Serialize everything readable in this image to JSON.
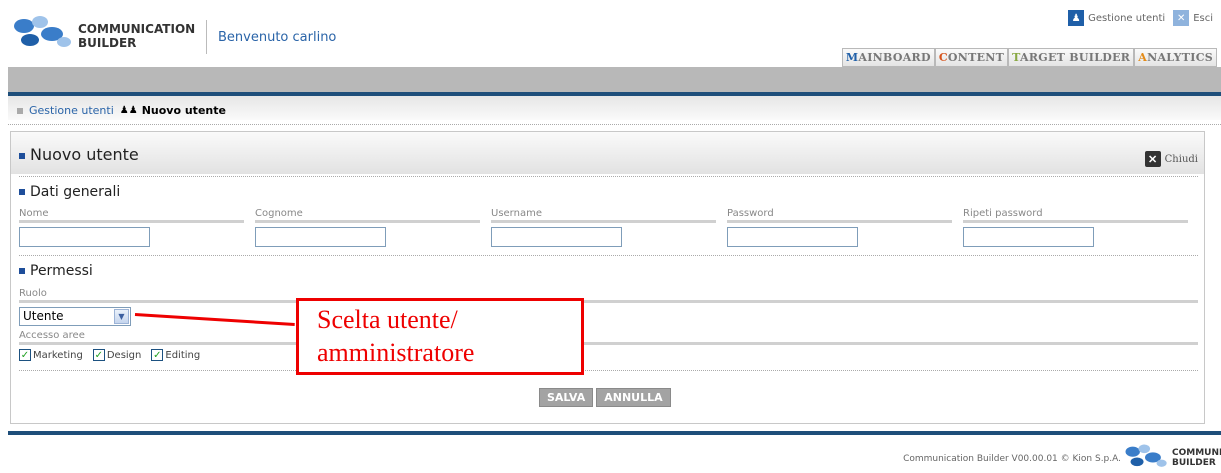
{
  "brand": {
    "line1": "COMMUNICATION",
    "line2": "BUILDER",
    "colors": [
      "#3a7dc9",
      "#9fc3ea",
      "#1f5fa8"
    ]
  },
  "header": {
    "welcome": "Benvenuto carlino",
    "links": {
      "users_icon": "users-icon",
      "users": "Gestione utenti",
      "exit_icon": "exit-icon",
      "exit": "Esci"
    },
    "tabs": [
      {
        "first": "M",
        "rest": "AINBOARD"
      },
      {
        "first": "C",
        "rest": "ONTENT"
      },
      {
        "first": "T",
        "rest": "ARGET BUILDER"
      },
      {
        "first": "A",
        "rest": "NALYTICS"
      }
    ]
  },
  "breadcrumb": {
    "link": "Gestione utenti",
    "current": "Nuovo utente"
  },
  "panel": {
    "title": "Nuovo utente",
    "close": "Chiudi",
    "general": {
      "title": "Dati generali",
      "fields": [
        {
          "label": "Nome",
          "value": ""
        },
        {
          "label": "Cognome",
          "value": ""
        },
        {
          "label": "Username",
          "value": ""
        },
        {
          "label": "Password",
          "value": ""
        },
        {
          "label": "Ripeti password",
          "value": ""
        }
      ]
    },
    "permissions": {
      "title": "Permessi",
      "role_label": "Ruolo",
      "role_value": "Utente",
      "areas_label": "Accesso aree",
      "areas": [
        {
          "label": "Marketing",
          "checked": true
        },
        {
          "label": "Design",
          "checked": true
        },
        {
          "label": "Editing",
          "checked": true
        }
      ]
    },
    "buttons": {
      "save": "SALVA",
      "cancel": "ANNULLA"
    }
  },
  "annotation": {
    "line1": "Scelta utente/",
    "line2": "amministratore",
    "color": "#e00000"
  },
  "footer": {
    "text": "Communication Builder V00.00.01 © Kion S.p.A.",
    "logo_line1": "COMMUNICATION",
    "logo_line2": "BUILDER"
  }
}
